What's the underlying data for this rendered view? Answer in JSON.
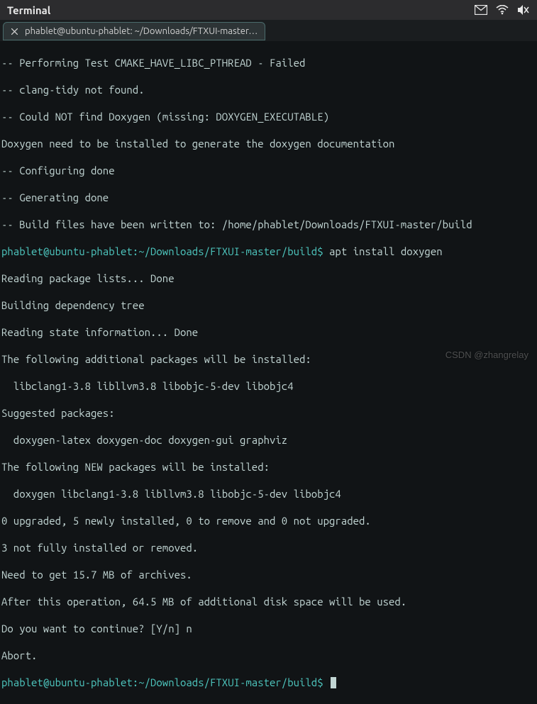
{
  "header": {
    "title": "Terminal"
  },
  "tab": {
    "title": "phablet@ubuntu-phablet: ~/Downloads/FTXUI-master…"
  },
  "prompt": "phablet@ubuntu-phablet:~/Downloads/FTXUI-master/build$",
  "commands": {
    "apt_install": "apt install doxygen"
  },
  "output": {
    "l01": "-- Performing Test CMAKE_HAVE_LIBC_PTHREAD - Failed",
    "l02": "-- clang-tidy not found.",
    "l03": "-- Could NOT find Doxygen (missing: DOXYGEN_EXECUTABLE)",
    "l04": "Doxygen need to be installed to generate the doxygen documentation",
    "l05": "-- Configuring done",
    "l06": "-- Generating done",
    "l07": "-- Build files have been written to: /home/phablet/Downloads/FTXUI-master/build",
    "l08": "Reading package lists... Done",
    "l09": "Building dependency tree",
    "l10": "Reading state information... Done",
    "l11": "The following additional packages will be installed:",
    "l12": "  libclang1-3.8 libllvm3.8 libobjc-5-dev libobjc4",
    "l13": "Suggested packages:",
    "l14": "  doxygen-latex doxygen-doc doxygen-gui graphviz",
    "l15": "The following NEW packages will be installed:",
    "l16": "  doxygen libclang1-3.8 libllvm3.8 libobjc-5-dev libobjc4",
    "l17": "0 upgraded, 5 newly installed, 0 to remove and 0 not upgraded.",
    "l18": "3 not fully installed or removed.",
    "l19": "Need to get 15.7 MB of archives.",
    "l20": "After this operation, 64.5 MB of additional disk space will be used.",
    "l21": "Do you want to continue? [Y/n] n",
    "l22": "Abort."
  },
  "watermark": "CSDN @zhangrelay"
}
